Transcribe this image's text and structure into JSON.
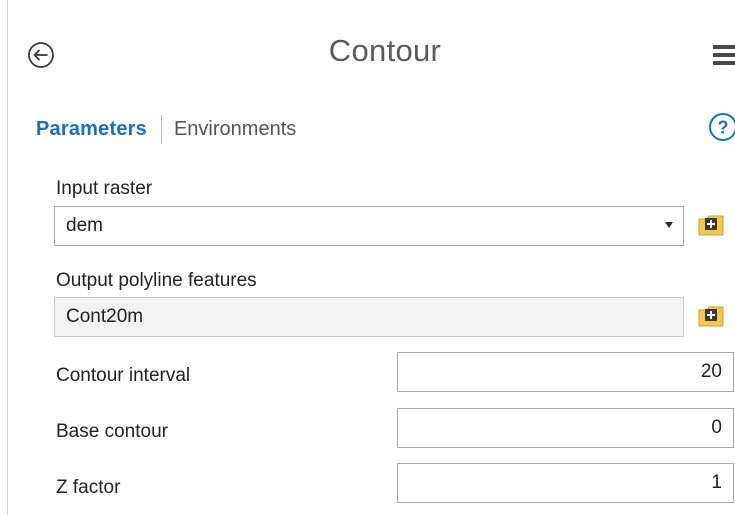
{
  "header": {
    "title": "Contour",
    "back_icon": "back-arrow-circle-icon",
    "menu_icon": "hamburger-menu-icon"
  },
  "tabs": {
    "parameters": "Parameters",
    "environments": "Environments",
    "help_icon": "help-question-icon"
  },
  "form": {
    "input_raster": {
      "label": "Input raster",
      "value": "dem",
      "browse_icon": "browse-folder-add-icon"
    },
    "output_features": {
      "label": "Output polyline features",
      "value": "Cont20m",
      "browse_icon": "browse-folder-add-icon"
    },
    "contour_interval": {
      "label": "Contour interval",
      "value": "20"
    },
    "base_contour": {
      "label": "Base contour",
      "value": "0"
    },
    "z_factor": {
      "label": "Z factor",
      "value": "1"
    }
  },
  "colors": {
    "accent": "#1a6fbf",
    "folder": "#f2c94c"
  }
}
